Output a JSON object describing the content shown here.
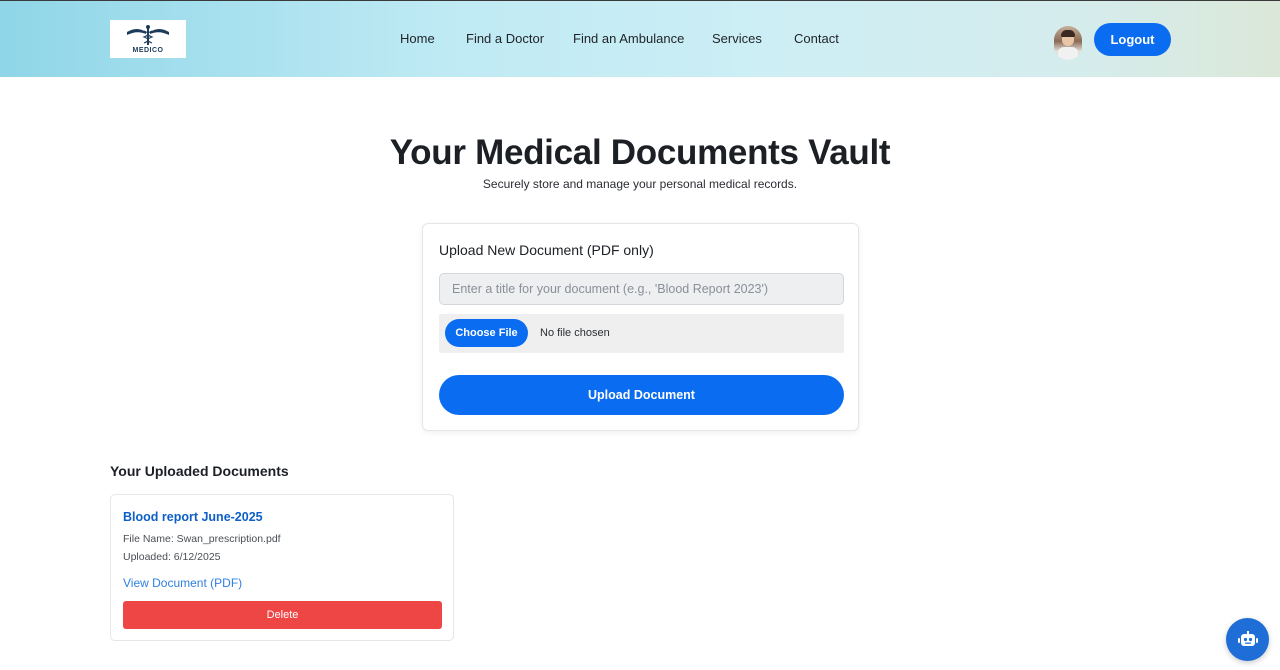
{
  "header": {
    "logo_text": "MEDICO",
    "nav": [
      {
        "label": "Home"
      },
      {
        "label": "Find a Doctor"
      },
      {
        "label": "Find an Ambulance"
      },
      {
        "label": "Services"
      },
      {
        "label": "Contact"
      }
    ],
    "logout_label": "Logout",
    "avatar_icon": "user-avatar-photo"
  },
  "main": {
    "title": "Your Medical Documents Vault",
    "subtitle": "Securely store and manage your personal medical records."
  },
  "upload": {
    "heading": "Upload New Document (PDF only)",
    "title_value": "",
    "title_placeholder": "Enter a title for your document (e.g., 'Blood Report 2023')",
    "choose_file_label": "Choose File",
    "file_status": "No file chosen",
    "submit_label": "Upload Document"
  },
  "documents": {
    "heading": "Your Uploaded Documents",
    "items": [
      {
        "title": "Blood report June-2025",
        "file_name": "File Name: Swan_prescription.pdf",
        "uploaded": "Uploaded: 6/12/2025",
        "view_label": "View Document (PDF)",
        "delete_label": "Delete"
      }
    ]
  },
  "chatbot": {
    "icon": "robot-icon"
  },
  "colors": {
    "primary": "#0a6cf1",
    "danger": "#ee4545",
    "link": "#0d5fc7"
  }
}
